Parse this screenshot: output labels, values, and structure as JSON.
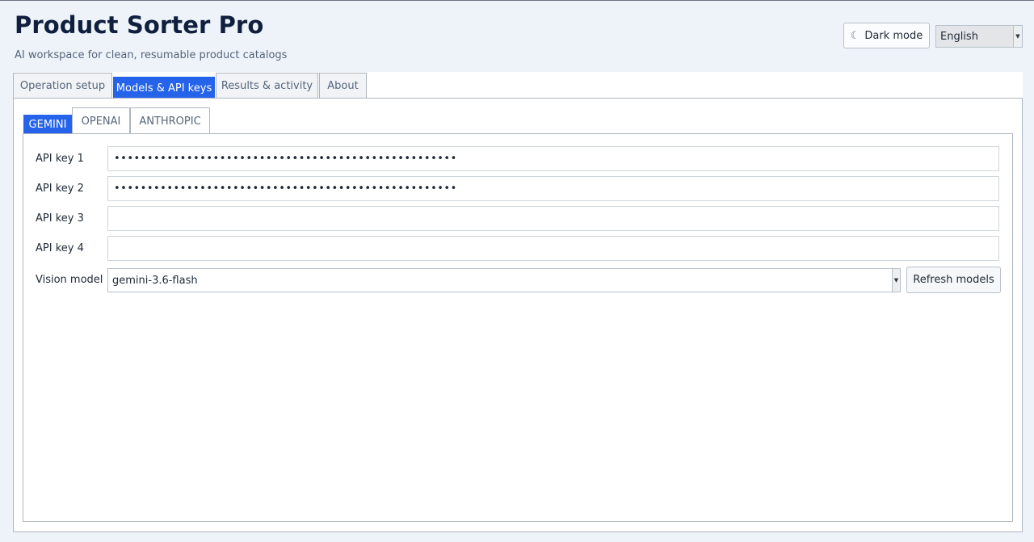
{
  "app": {
    "title": "Product Sorter Pro",
    "subtitle": "AI workspace for clean, resumable product catalogs"
  },
  "header": {
    "dark_mode_icon": "moon-icon",
    "dark_mode_glyph": "☾",
    "dark_mode_label": "Dark mode",
    "language": "English"
  },
  "main_tabs": [
    {
      "label": "Operation setup",
      "active": false
    },
    {
      "label": "Models & API keys",
      "active": true
    },
    {
      "label": "Results & activity",
      "active": false
    },
    {
      "label": "About",
      "active": false
    }
  ],
  "provider_tabs": [
    {
      "label": "GEMINI",
      "active": true
    },
    {
      "label": "OPENAI",
      "active": false
    },
    {
      "label": "ANTHROPIC",
      "active": false
    }
  ],
  "form": {
    "api_keys": [
      {
        "label": "API key 1",
        "value": "••••••••••••••••••••••••••••••••••••••••••••••••••••"
      },
      {
        "label": "API key 2",
        "value": "••••••••••••••••••••••••••••••••••••••••••••••••••••"
      },
      {
        "label": "API key 3",
        "value": ""
      },
      {
        "label": "API key 4",
        "value": ""
      }
    ],
    "vision_model_label": "Vision model",
    "vision_model_value": "gemini-3.6-flash",
    "refresh_label": "Refresh models"
  },
  "colors": {
    "accent": "#2563eb",
    "background": "#eef3f9",
    "title": "#0f1f3d"
  }
}
